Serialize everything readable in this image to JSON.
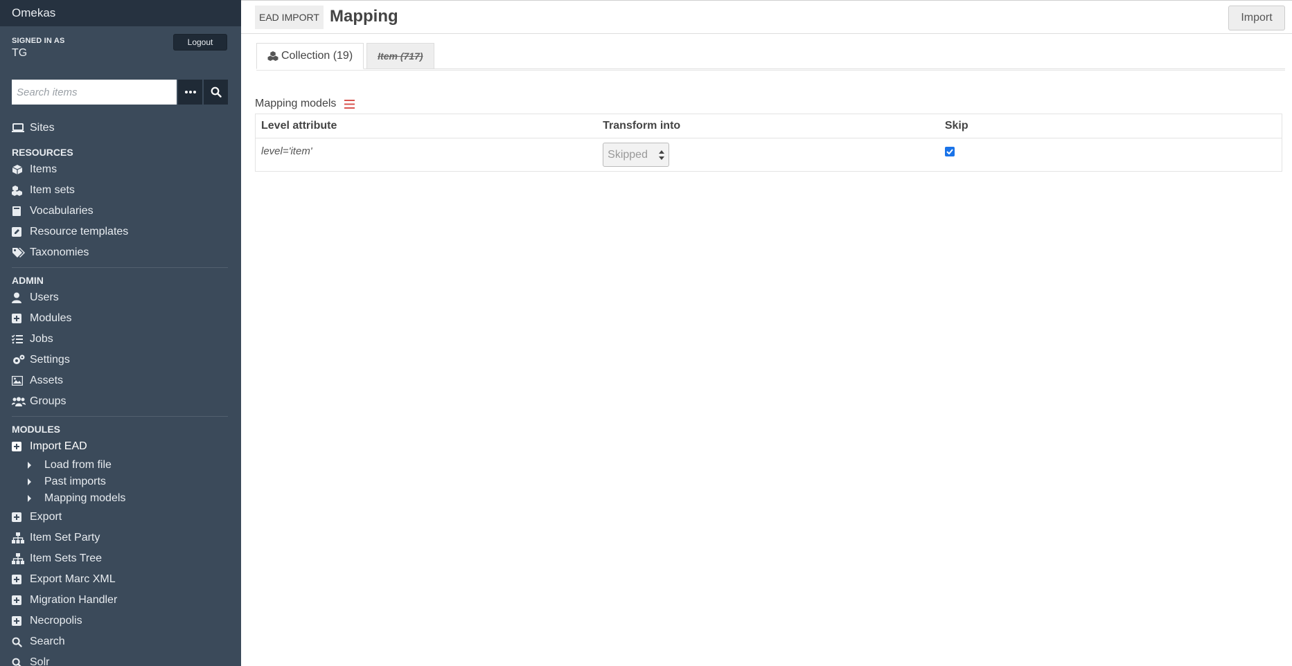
{
  "sidebar": {
    "brand": "Omekas",
    "signed_in_label": "SIGNED IN AS",
    "user": "TG",
    "logout_label": "Logout",
    "search": {
      "placeholder": "Search items"
    },
    "sites_label": "Sites",
    "resources": {
      "title": "RESOURCES",
      "items": [
        {
          "label": "Items",
          "icon": "cube-icon"
        },
        {
          "label": "Item sets",
          "icon": "cubes-icon"
        },
        {
          "label": "Vocabularies",
          "icon": "book-icon"
        },
        {
          "label": "Resource templates",
          "icon": "pencil-square-icon"
        },
        {
          "label": "Taxonomies",
          "icon": "tags-icon"
        }
      ]
    },
    "admin": {
      "title": "ADMIN",
      "items": [
        {
          "label": "Users",
          "icon": "user-icon"
        },
        {
          "label": "Modules",
          "icon": "plus-square-icon"
        },
        {
          "label": "Jobs",
          "icon": "tasks-icon"
        },
        {
          "label": "Settings",
          "icon": "cogs-icon"
        },
        {
          "label": "Assets",
          "icon": "image-icon"
        },
        {
          "label": "Groups",
          "icon": "users-icon"
        }
      ]
    },
    "modules": {
      "title": "MODULES",
      "active_module": "Import EAD",
      "sub_items": [
        "Load from file",
        "Past imports",
        "Mapping models"
      ],
      "items": [
        {
          "label": "Export",
          "icon": "plus-square-icon"
        },
        {
          "label": "Item Set Party",
          "icon": "sitemap-icon"
        },
        {
          "label": "Item Sets Tree",
          "icon": "sitemap-icon"
        },
        {
          "label": "Export Marc XML",
          "icon": "plus-square-icon"
        },
        {
          "label": "Migration Handler",
          "icon": "plus-square-icon"
        },
        {
          "label": "Necropolis",
          "icon": "plus-square-icon"
        },
        {
          "label": "Search",
          "icon": "search-icon"
        },
        {
          "label": "Solr",
          "icon": "search-icon"
        }
      ]
    }
  },
  "header": {
    "badge": "EAD IMPORT",
    "title": "Mapping",
    "import_label": "Import"
  },
  "tabs": [
    {
      "label": "Collection (19)"
    },
    {
      "label": "Item (717)"
    }
  ],
  "mapping": {
    "label": "Mapping models",
    "columns": [
      "Level attribute",
      "Transform into",
      "Skip"
    ],
    "rows": [
      {
        "level": "level='item'",
        "transform": "Skipped",
        "skip": true
      }
    ]
  },
  "colors": {
    "sidebar_bg": "#3b4a5a",
    "topbar_bg": "#263240",
    "accent_red": "#d9534f",
    "checkbox_blue": "#1a73e8"
  }
}
